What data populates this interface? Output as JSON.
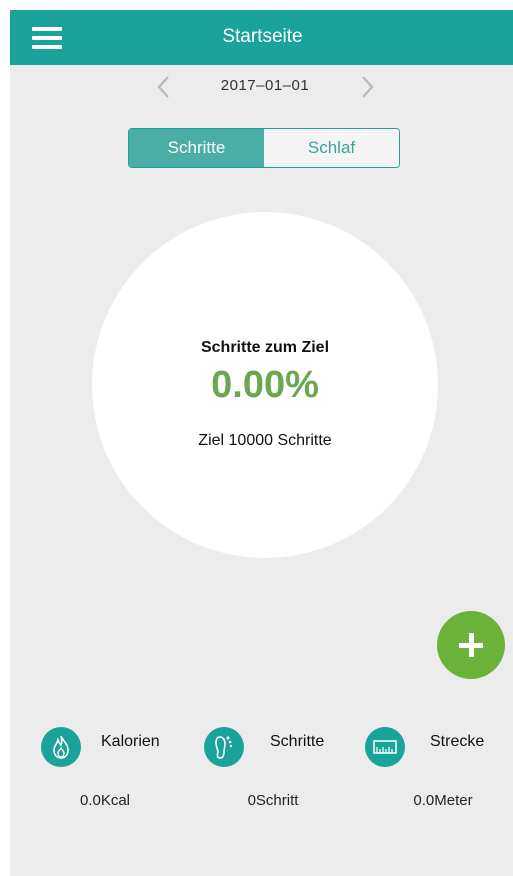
{
  "header": {
    "title": "Startseite",
    "menu_icon": "hamburger-menu-icon"
  },
  "date_nav": {
    "date": "2017–01–01",
    "prev_icon": "chevron-left-icon",
    "next_icon": "chevron-right-icon"
  },
  "tabs": [
    {
      "label": "Schritte",
      "active": true
    },
    {
      "label": "Schlaf",
      "active": false
    }
  ],
  "progress": {
    "title": "Schritte zum Ziel",
    "percent": "0.00%",
    "goal": "Ziel 10000 Schritte"
  },
  "fab": {
    "icon": "plus-icon"
  },
  "stats": [
    {
      "label": "Kalorien",
      "value": "0.0Kcal",
      "icon": "flame-icon"
    },
    {
      "label": "Schritte",
      "value": "0Schritt",
      "icon": "footprint-icon"
    },
    {
      "label": "Strecke",
      "value": "0.0Meter",
      "icon": "ruler-icon"
    }
  ],
  "colors": {
    "accent": "#1aa39b",
    "active_tab": "#4aaea6",
    "percent": "#6aa84f",
    "fab": "#6ab23a",
    "background": "#ececec"
  }
}
